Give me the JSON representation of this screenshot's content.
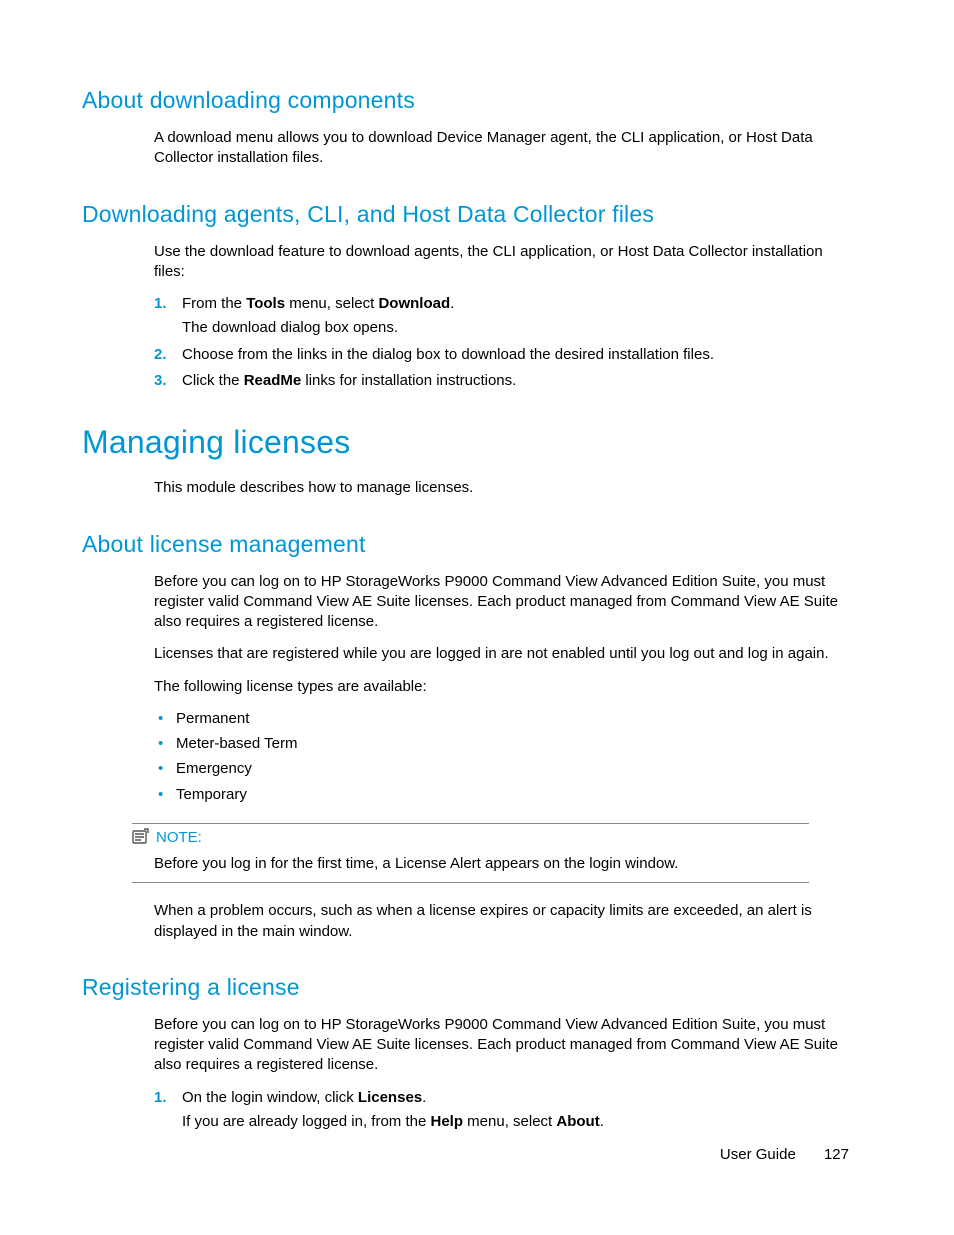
{
  "sec1": {
    "heading": "About downloading components",
    "body": "A download menu allows you to download Device Manager agent, the CLI application, or Host Data Collector installation files."
  },
  "sec2": {
    "heading": "Downloading agents, CLI, and Host Data Collector files",
    "intro": "Use the download feature to download agents, the CLI application, or Host Data Collector installation files:",
    "step1_a": "From the ",
    "step1_b": "Tools",
    "step1_c": " menu, select ",
    "step1_d": "Download",
    "step1_e": ".",
    "step1_sub": "The download dialog box opens.",
    "step2": "Choose from the links in the dialog box to download the desired installation files.",
    "step3_a": "Click the ",
    "step3_b": "ReadMe",
    "step3_c": " links for installation instructions."
  },
  "sec3": {
    "heading": "Managing licenses",
    "intro": "This module describes how to manage licenses."
  },
  "sec4": {
    "heading": "About license management",
    "p1": "Before you can log on to HP StorageWorks P9000 Command View Advanced Edition Suite, you must register valid Command View AE Suite licenses. Each product managed from Command View AE Suite also requires a registered license.",
    "p2": "Licenses that are registered while you are logged in are not enabled until you log out and log in again.",
    "p3": "The following license types are available:",
    "li1": "Permanent",
    "li2": "Meter-based Term",
    "li3": "Emergency",
    "li4": "Temporary",
    "note_label": "NOTE:",
    "note_body": "Before you log in for the first time, a License Alert appears on the login window.",
    "p4": "When a problem occurs, such as when a license expires or capacity limits are exceeded, an alert is displayed in the main window."
  },
  "sec5": {
    "heading": "Registering a license",
    "p1": "Before you can log on to HP StorageWorks P9000 Command View Advanced Edition Suite, you must register valid Command View AE Suite licenses. Each product managed from Command View AE Suite also requires a registered license.",
    "step1_a": "On the login window, click ",
    "step1_b": "Licenses",
    "step1_c": ".",
    "step1_sub_a": "If you are already logged in, from the ",
    "step1_sub_b": "Help",
    "step1_sub_c": " menu, select ",
    "step1_sub_d": "About",
    "step1_sub_e": "."
  },
  "footer": {
    "title": "User Guide",
    "page": "127"
  }
}
